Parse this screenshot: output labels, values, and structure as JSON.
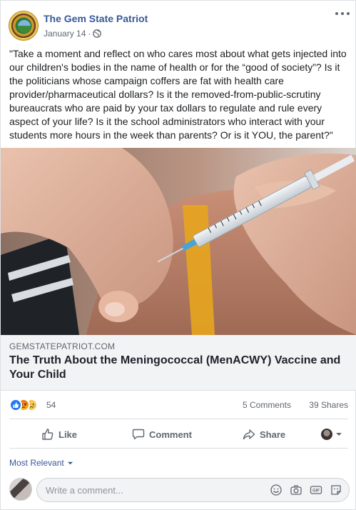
{
  "post": {
    "page_name": "The Gem State Patriot",
    "date": "January 14",
    "separator": "·",
    "audience_icon": "globe-icon",
    "text": "\"Take a moment and reflect on who cares most about what gets injected into our children's bodies in the name of health or for the “good of society”? Is it the politicians whose campaign coffers are fat with health care provider/pharmaceutical dollars? Is it the removed-from-public-scrutiny bureaucrats who are paid by your tax dollars to regulate and rule every aspect of your life? Is it the school administrators who interact with your students more hours in the week than parents? Or is it YOU, the parent?\""
  },
  "link_preview": {
    "domain": "GEMSTATEPATRIOT.COM",
    "title": "The Truth About the Meningococcal (MenACWY) Vaccine and Your Child"
  },
  "stats": {
    "reactions_count": "54",
    "reaction_types": [
      "like",
      "angry",
      "sad"
    ],
    "comments": "5 Comments",
    "shares": "39 Shares"
  },
  "actions": {
    "like": "Like",
    "comment": "Comment",
    "share": "Share"
  },
  "comments_section": {
    "sort_label": "Most Relevant",
    "input_placeholder": "Write a comment..."
  },
  "colors": {
    "link_blue": "#385898",
    "meta_gray": "#606770",
    "like_blue": "#2078f4",
    "preview_bg": "#f2f3f5"
  }
}
